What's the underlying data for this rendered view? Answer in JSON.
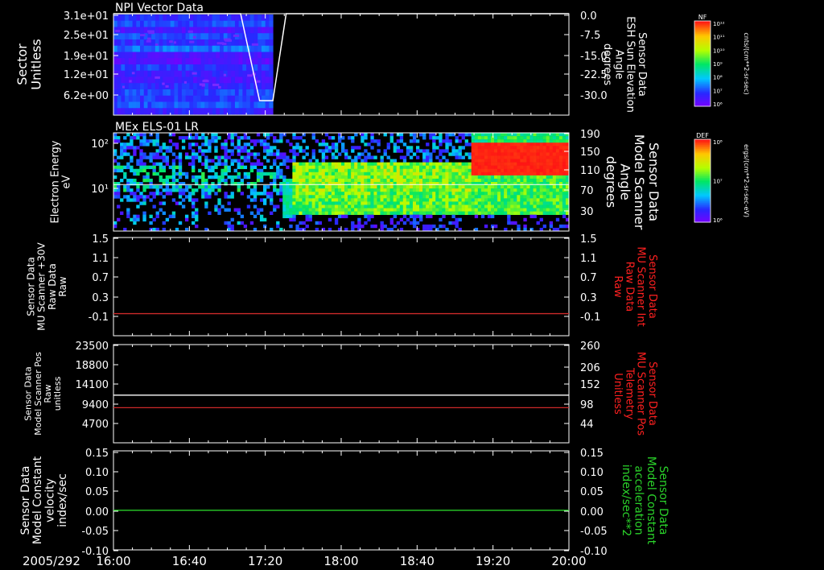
{
  "chart_data": [
    {
      "type": "heatmap",
      "title": "NPI Vector Data",
      "ylabel_left": [
        "Sector",
        "Unitless"
      ],
      "yticks_left": [
        "3.1e+01",
        "2.5e+01",
        "1.9e+01",
        "1.2e+01",
        "6.2e+00"
      ],
      "ylabel_right": [
        "Sensor Data",
        "ESH Sun Elevation",
        "Angle",
        "degrees"
      ],
      "yticks_right": [
        "0.0",
        "-7.5",
        "-15.0",
        "-22.5",
        "-30.0"
      ],
      "ylim_right": [
        -35,
        0
      ],
      "line": {
        "color": "#ffffff",
        "points": [
          [
            "16:00",
            0
          ],
          [
            "17:07",
            0
          ],
          [
            "17:17",
            -30
          ],
          [
            "17:24",
            -30
          ],
          [
            "17:31",
            0
          ],
          [
            "20:00",
            0
          ]
        ]
      },
      "data_end": "17:24",
      "colorbar": {
        "label": "NF",
        "ticks": [
          "10¹²",
          "10¹¹",
          "10¹⁰",
          "10⁹",
          "10⁸",
          "10⁷",
          "10⁶"
        ],
        "units": "cnts/(cm**2-sr-sec)"
      }
    },
    {
      "type": "heatmap",
      "title": "MEx ELS-01 LR",
      "ylabel_left": [
        "Electron Energy",
        "eV"
      ],
      "yticks_left": [
        "10²",
        "10¹"
      ],
      "ylabel_right": [
        "Sensor Data",
        "Model Scanner",
        "Angle",
        "degrees"
      ],
      "yticks_right": [
        "190",
        "150",
        "110",
        "70",
        "30"
      ],
      "ylim_right": [
        0,
        190
      ],
      "line": {
        "color": "#ffffff",
        "value": 90
      },
      "colorbar": {
        "label": "DEF",
        "ticks": [
          "10⁸",
          "10⁷",
          "10⁶"
        ],
        "units": "ergs/(cm**2-sr-sec-eV)"
      }
    },
    {
      "type": "line",
      "ylabel_left": [
        "Sensor Data",
        "MU Scanner +30V",
        "Raw Data",
        "Raw"
      ],
      "yticks_left": [
        "1.5",
        "1.1",
        "0.7",
        "0.3",
        "-0.1"
      ],
      "ylabel_right": [
        "Sensor Data",
        "MU Scanner Int",
        "Raw Data",
        "Raw"
      ],
      "yticks_right": [
        "1.5",
        "1.1",
        "0.7",
        "0.3",
        "-0.1"
      ],
      "ylim": [
        -0.5,
        1.5
      ],
      "series": [
        {
          "color": "#cc2a2a",
          "value": -0.05
        }
      ]
    },
    {
      "type": "line",
      "ylabel_left": [
        "Sensor Data",
        "Model Scanner Pos",
        "Raw",
        "unitless"
      ],
      "yticks_left": [
        "23500",
        "18800",
        "14100",
        "9400",
        "4700"
      ],
      "ylabel_right": [
        "Sensor Data",
        "MU Scanner Pos",
        "Telemetry",
        "Unitless"
      ],
      "yticks_right": [
        "260",
        "206",
        "152",
        "98",
        "44"
      ],
      "ylim_left": [
        0,
        23500
      ],
      "series": [
        {
          "color": "#ffffff",
          "value": 11400
        },
        {
          "color": "#cc2a2a",
          "value": 8400
        }
      ]
    },
    {
      "type": "line",
      "ylabel_left": [
        "Sensor Data",
        "Model Constant",
        "velocity",
        "index/sec"
      ],
      "yticks_left": [
        "0.15",
        "0.10",
        "0.05",
        "0.00",
        "-0.05",
        "-0.10"
      ],
      "ylabel_right": [
        "Sensor Data",
        "Model Constant",
        "acceleration",
        "index/sec**2"
      ],
      "yticks_right": [
        "0.15",
        "0.10",
        "0.05",
        "0.00",
        "-0.05",
        "-0.10"
      ],
      "ylim": [
        -0.1,
        0.15
      ],
      "series": [
        {
          "color": "#2ad12a",
          "value": 0.0
        }
      ]
    }
  ],
  "time_axis": {
    "date": "2005/292",
    "ticks": [
      "16:00",
      "16:40",
      "17:20",
      "18:00",
      "18:40",
      "19:20",
      "20:00"
    ]
  },
  "colors": {
    "right_label_panel3": "#ff2020",
    "right_label_panel4": "#ff2020",
    "right_label_panel5": "#2ad12a"
  }
}
